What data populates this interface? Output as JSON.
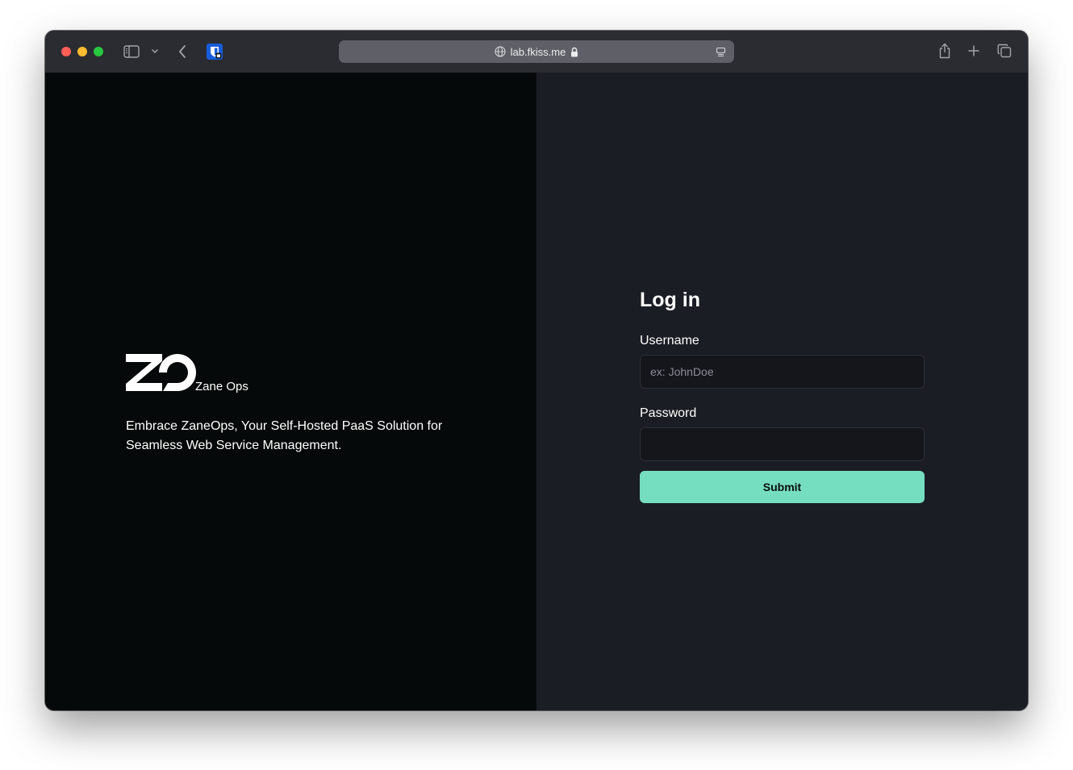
{
  "browser": {
    "url": "lab.fkiss.me",
    "traffic_lights": {
      "close": "#ff5f57",
      "minimize": "#febc2e",
      "maximize": "#28c840"
    },
    "icons": [
      "sidebar-icon",
      "chevron-down-icon",
      "back-icon",
      "bitwarden-icon",
      "globe-icon",
      "lock-icon",
      "reader-icon",
      "share-icon",
      "plus-icon",
      "tabs-icon"
    ]
  },
  "brand": {
    "logo_text": "ZO",
    "name": "Zane Ops",
    "tagline": "Embrace ZaneOps, Your Self-Hosted PaaS Solution for Seamless Web Service Management."
  },
  "login": {
    "title": "Log in",
    "username_label": "Username",
    "username_placeholder": "ex: JohnDoe",
    "username_value": "",
    "password_label": "Password",
    "password_value": "",
    "submit_label": "Submit"
  },
  "colors": {
    "accent": "#76dec0",
    "left_background": "#060909",
    "right_background": "#1b1d24"
  }
}
